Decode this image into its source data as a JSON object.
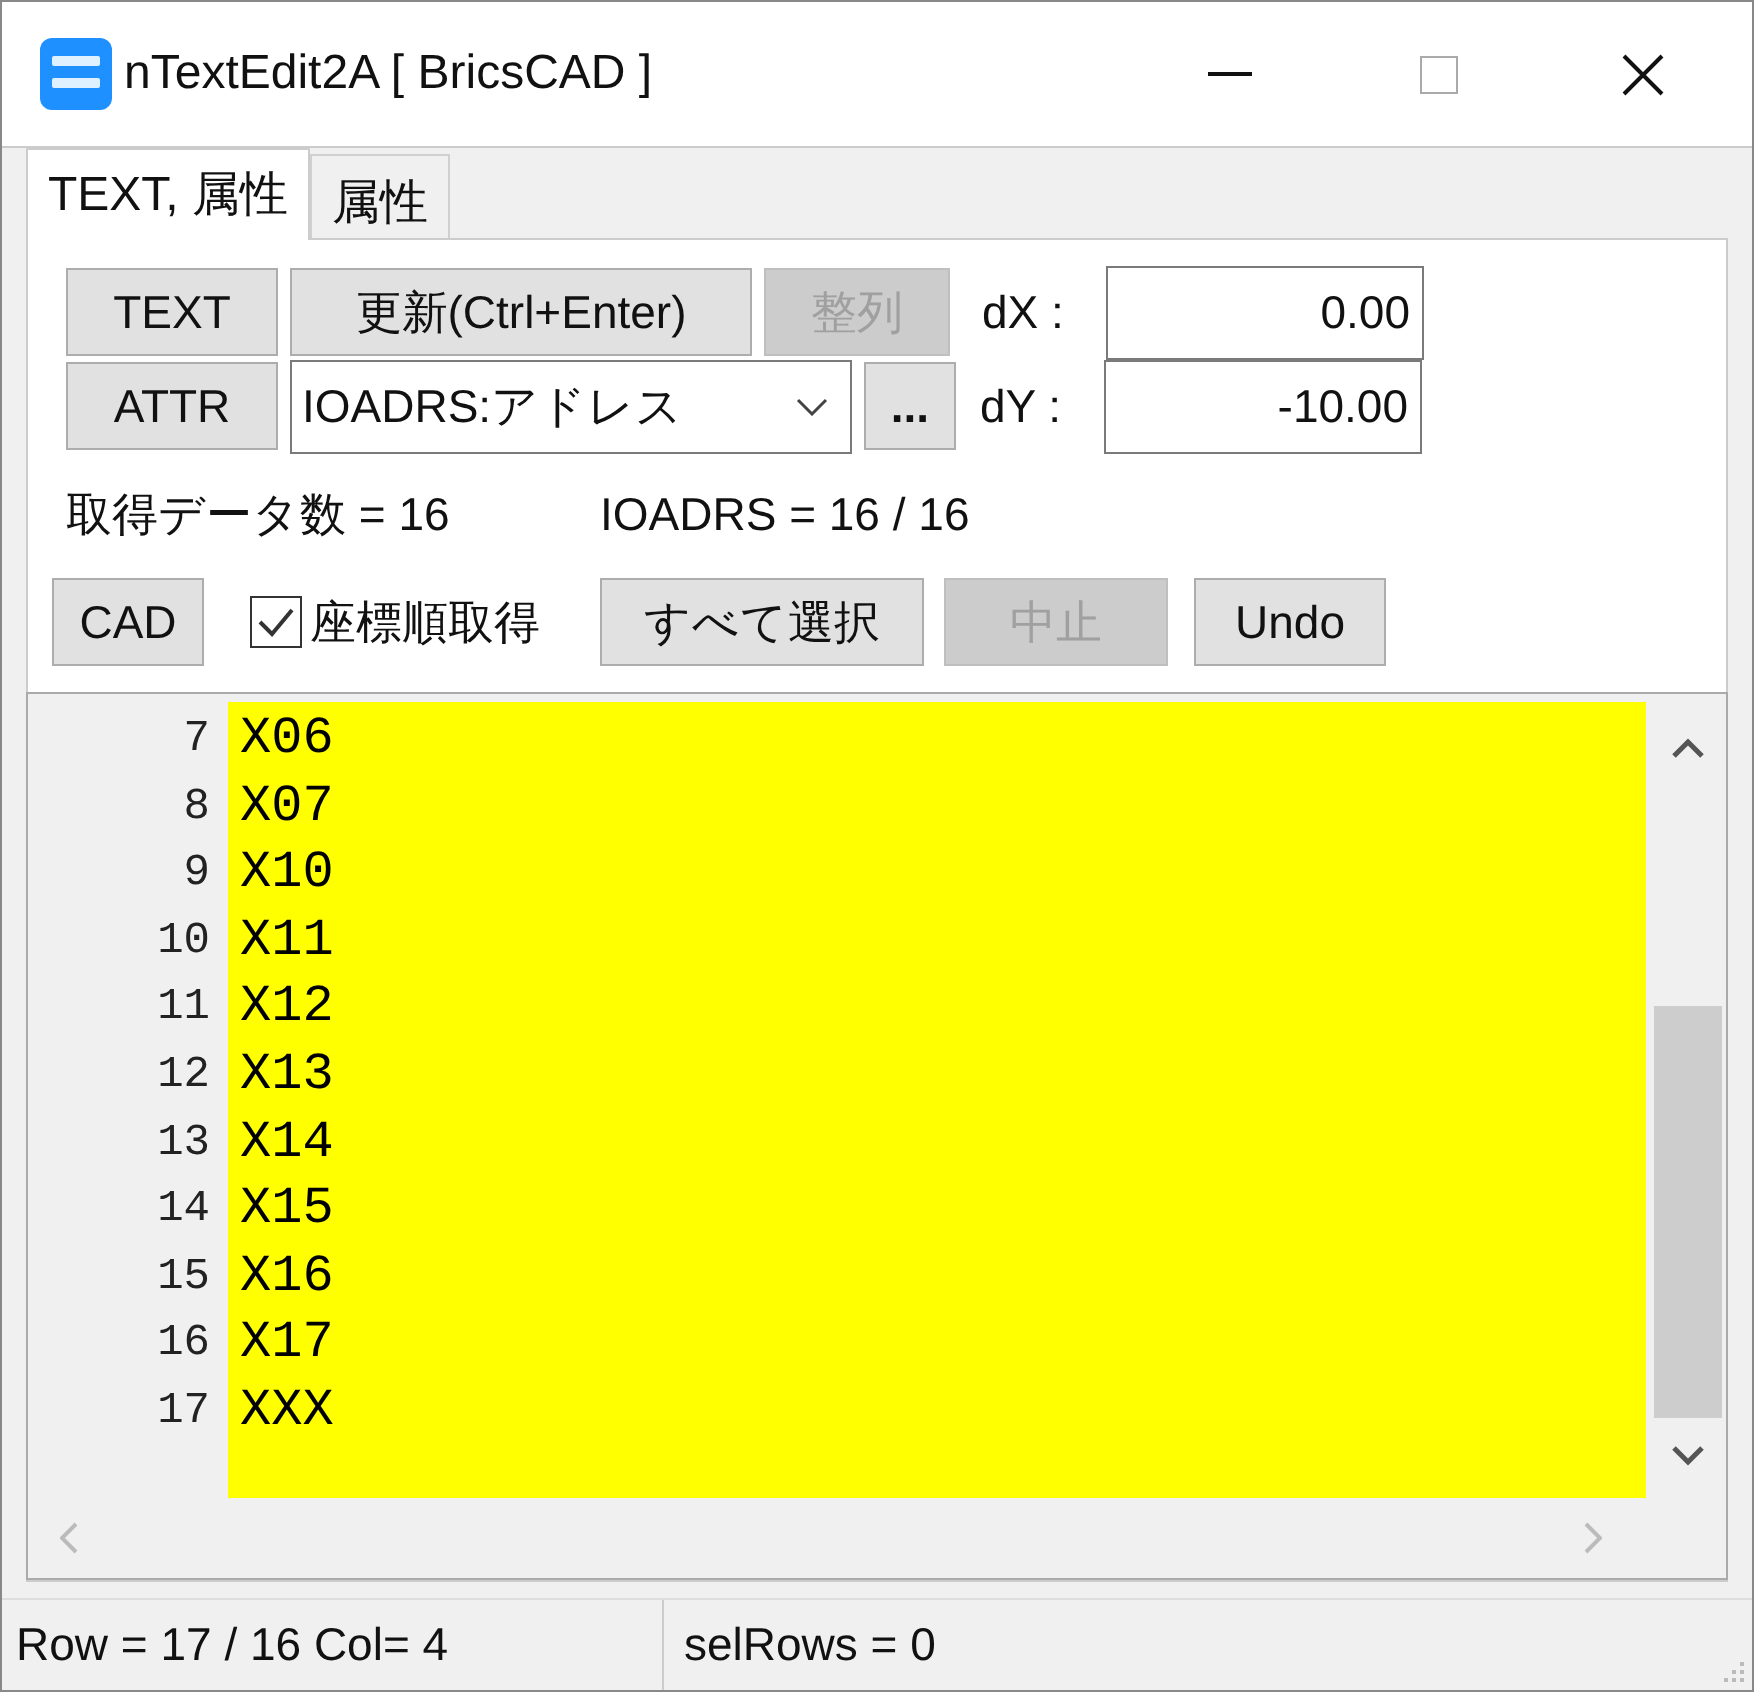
{
  "window": {
    "title": "nTextEdit2A [ BricsCAD ]"
  },
  "tabs": [
    {
      "label": "TEXT, 属性",
      "selected": true
    },
    {
      "label": "属性",
      "selected": false
    }
  ],
  "text_button": {
    "label": "TEXT",
    "disabled": false
  },
  "update_button": {
    "label": "更新(Ctrl+Enter)",
    "disabled": false
  },
  "align_button": {
    "label": "整列",
    "disabled": true
  },
  "dx": {
    "label": "dX :",
    "value": "0.00"
  },
  "attr_button": {
    "label": "ATTR",
    "disabled": false
  },
  "attribute_select": {
    "value": "IOADRS:アドレス"
  },
  "more_button": {
    "label": "...",
    "disabled": false
  },
  "dy": {
    "label": "dY :",
    "value": "-10.00"
  },
  "data_count": "取得データ数 = 16",
  "attr_count": "IOADRS = 16 / 16",
  "cad_button": {
    "label": "CAD",
    "disabled": false
  },
  "coord_order": {
    "label": "座標順取得",
    "checked": true
  },
  "select_all_button": {
    "label": "すべて選択",
    "disabled": false
  },
  "stop_button": {
    "label": "中止",
    "disabled": true
  },
  "undo_button": {
    "label": "Undo",
    "disabled": false
  },
  "editor": {
    "lines": [
      {
        "number": "7",
        "text": "X06"
      },
      {
        "number": "8",
        "text": "X07"
      },
      {
        "number": "9",
        "text": "X10"
      },
      {
        "number": "10",
        "text": "X11"
      },
      {
        "number": "11",
        "text": "X12"
      },
      {
        "number": "12",
        "text": "X13"
      },
      {
        "number": "13",
        "text": "X14"
      },
      {
        "number": "14",
        "text": "X15"
      },
      {
        "number": "15",
        "text": "X16"
      },
      {
        "number": "16",
        "text": "X17"
      },
      {
        "number": "17",
        "text": "XXX"
      }
    ]
  },
  "status_bar": {
    "position": "Row = 17 / 16 Col= 4",
    "selection": "selRows = 0"
  }
}
